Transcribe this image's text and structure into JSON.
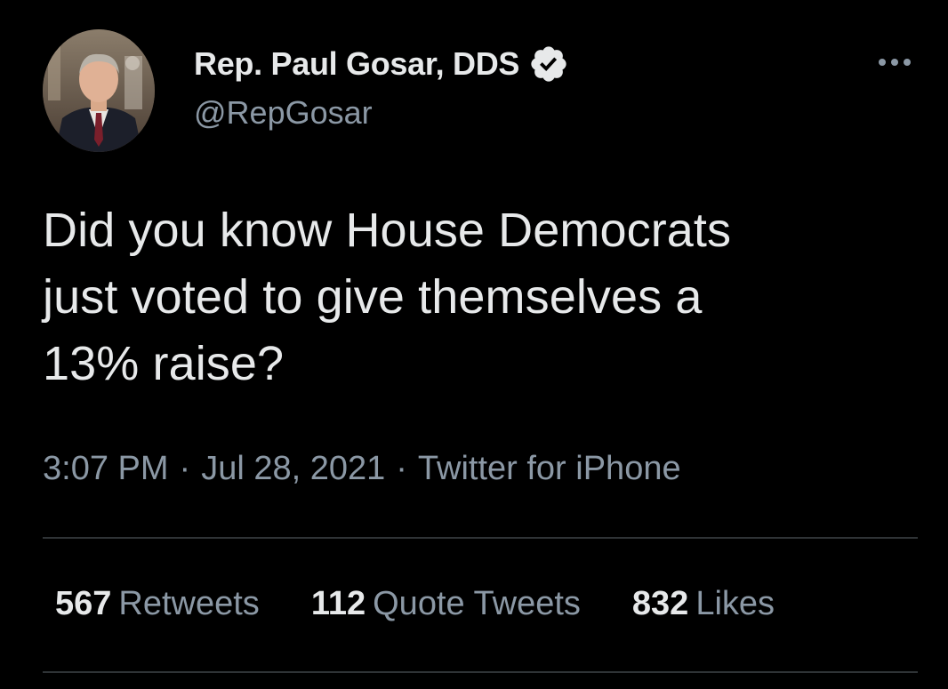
{
  "author": {
    "display_name": "Rep. Paul Gosar, DDS",
    "handle": "@RepGosar",
    "verified": true
  },
  "tweet": {
    "text": "Did you know House Democrats\njust voted to give themselves a\n13% raise?"
  },
  "meta": {
    "time": "3:07 PM",
    "date": "Jul 28, 2021",
    "separator": "·",
    "source": "Twitter for iPhone"
  },
  "stats": {
    "retweets_count": "567",
    "retweets_label": "Retweets",
    "quotes_count": "112",
    "quotes_label": "Quote Tweets",
    "likes_count": "832",
    "likes_label": "Likes"
  },
  "icons": {
    "verified": "verified-badge-icon",
    "more": "more-horizontal-icon"
  },
  "colors": {
    "background": "#000000",
    "primary_text": "#e7e9ea",
    "secondary_text": "#8b98a5",
    "divider": "#2f3336"
  }
}
